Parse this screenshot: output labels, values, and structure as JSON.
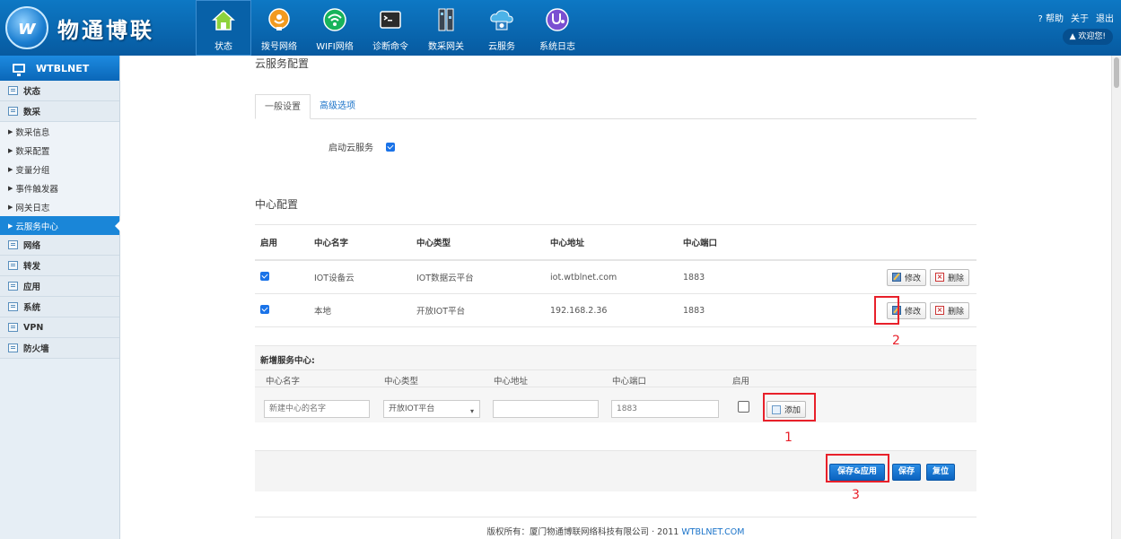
{
  "brand": {
    "name": "物通博联"
  },
  "topnav": [
    {
      "label": "状态",
      "icon": "home-icon",
      "active": true
    },
    {
      "label": "拨号网络",
      "icon": "dial-network-icon"
    },
    {
      "label": "WIFI网络",
      "icon": "wifi-icon"
    },
    {
      "label": "诊断命令",
      "icon": "terminal-icon"
    },
    {
      "label": "数采网关",
      "icon": "gateway-icon"
    },
    {
      "label": "云服务",
      "icon": "cloud-icon"
    },
    {
      "label": "系统日志",
      "icon": "stethoscope-icon"
    }
  ],
  "topright": {
    "help": "帮助",
    "about": "关于",
    "logout": "退出",
    "welcome": "欢迎您!"
  },
  "sidebar": {
    "head": "WTBLNET",
    "groups": [
      "状态",
      "数采"
    ],
    "subitems": [
      "数采信息",
      "数采配置",
      "变量分组",
      "事件触发器",
      "网关日志",
      "云服务中心"
    ],
    "groups2": [
      "网络",
      "转发",
      "应用",
      "系统",
      "VPN",
      "防火墙"
    ]
  },
  "main": {
    "page_title": "云服务配置",
    "tabs": [
      "一般设置",
      "高级选项"
    ],
    "enable_label": "启动云服务",
    "section_title": "中心配置",
    "table": {
      "headers": [
        "启用",
        "中心名字",
        "中心类型",
        "中心地址",
        "中心端口"
      ],
      "rows": [
        {
          "enabled": true,
          "name": "IOT设备云",
          "type": "IOT数据云平台",
          "address": "iot.wtblnet.com",
          "port": "1883"
        },
        {
          "enabled": true,
          "name": "本地",
          "type": "开放IOT平台",
          "address": "192.168.2.36",
          "port": "1883"
        }
      ],
      "edit_label": "修改",
      "delete_label": "删除"
    },
    "add": {
      "title": "新增服务中心:",
      "labels": [
        "中心名字",
        "中心类型",
        "中心地址",
        "中心端口",
        "启用"
      ],
      "name_placeholder": "新建中心的名字",
      "type_value": "开放IOT平台",
      "address_value": "",
      "port_placeholder": "1883",
      "add_label": "添加"
    },
    "buttons": {
      "save_apply": "保存&应用",
      "save": "保存",
      "reset": "复位"
    },
    "annotations": [
      "1",
      "2",
      "3"
    ]
  },
  "footer": {
    "text": "版权所有：厦门物通博联网络科技有限公司 · 2011 ",
    "link": "WTBLNET.COM"
  },
  "colors": {
    "header": "#0a6cb8",
    "accent_red": "#e8202a",
    "primary_button": "#1a73e8"
  }
}
